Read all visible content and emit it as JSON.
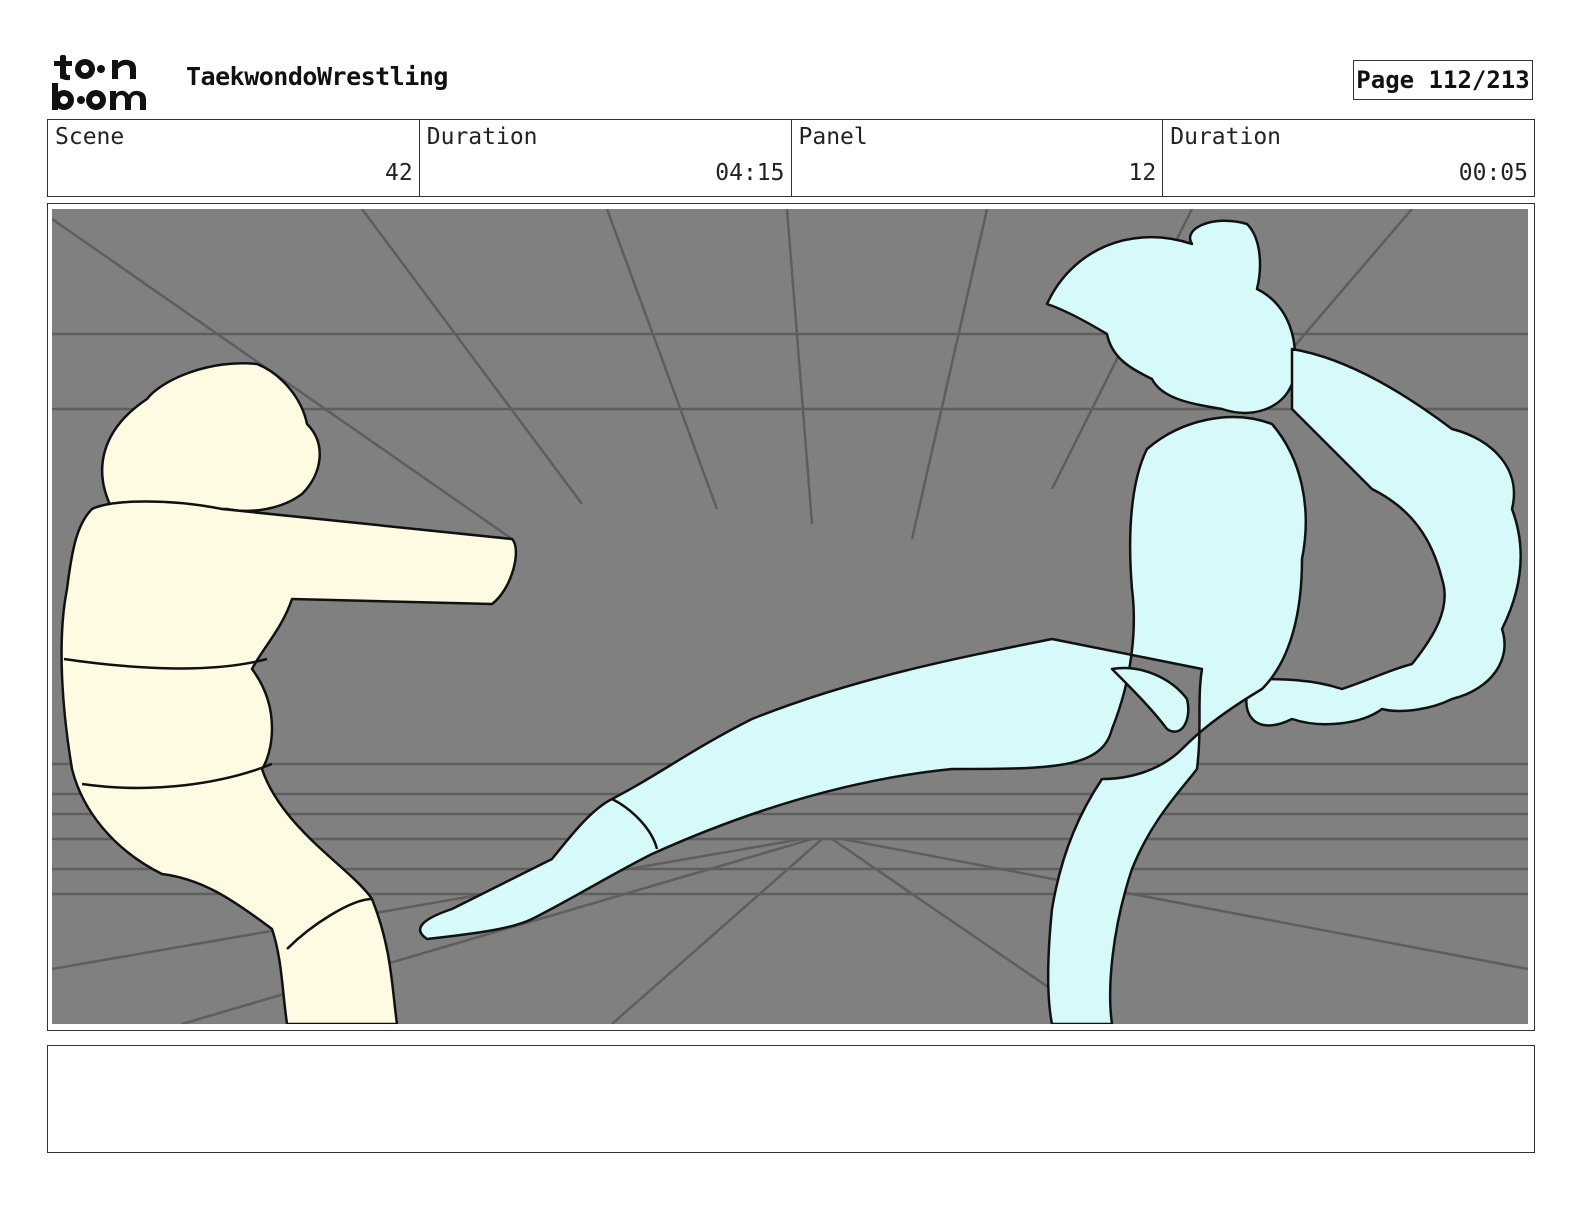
{
  "header": {
    "logo_text_top": "to•n",
    "logo_text_bottom": "b••m",
    "project_title": "TaekwondoWrestling",
    "page_label": "Page 112/213"
  },
  "info": [
    {
      "label": "Scene",
      "value": "42"
    },
    {
      "label": "Duration",
      "value": "04:15"
    },
    {
      "label": "Panel",
      "value": "12"
    },
    {
      "label": "Duration",
      "value": "00:05"
    }
  ],
  "panel": {
    "background_color": "#808080",
    "left_figure_color": "#fefbe2",
    "right_figure_color": "#d6fafa",
    "line_color": "#111111"
  },
  "notes": {
    "text": ""
  }
}
